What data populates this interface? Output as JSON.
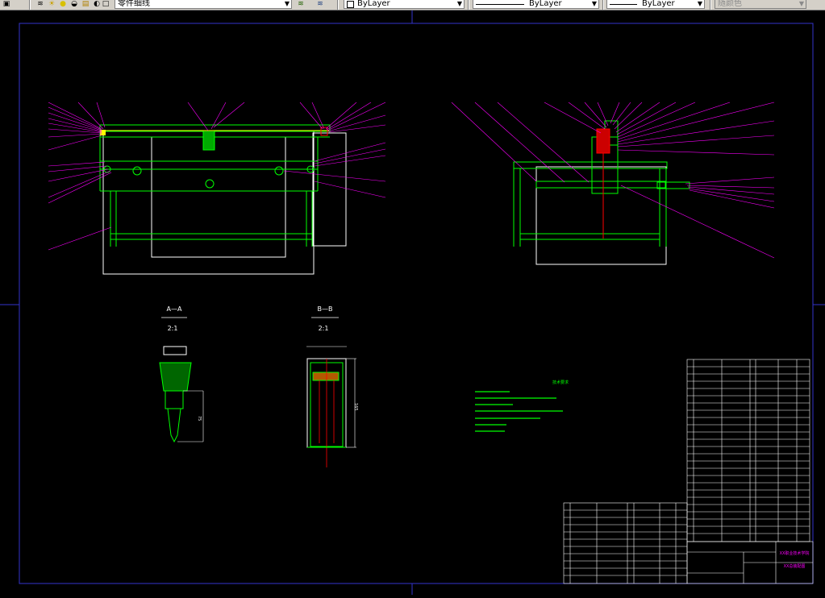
{
  "toolbar": {
    "layer_dropdown_value": "零件细线",
    "color_dropdown_value": "ByLayer",
    "linetype_dropdown_value": "ByLayer",
    "lineweight_dropdown_value": "ByLayer",
    "plotstyle_dropdown_value": "随颜色"
  },
  "drawing": {
    "section_aa_label": "A—A",
    "section_aa_scale": "2:1",
    "section_bb_label": "B—B",
    "section_bb_scale": "2:1",
    "tech_requirements_title": "技术要求",
    "dim_aa": "75",
    "dim_bb": "165",
    "title_block_company": "XX职业技术学院",
    "title_block_drawing_name": "XX总装配图"
  },
  "colors": {
    "frame": "#3333cc",
    "part_line": "#00ff00",
    "leader": "#ff00ff",
    "text": "#ffffff",
    "note": "#00ff00",
    "red": "#ff0000",
    "yellow": "#ffff00"
  }
}
